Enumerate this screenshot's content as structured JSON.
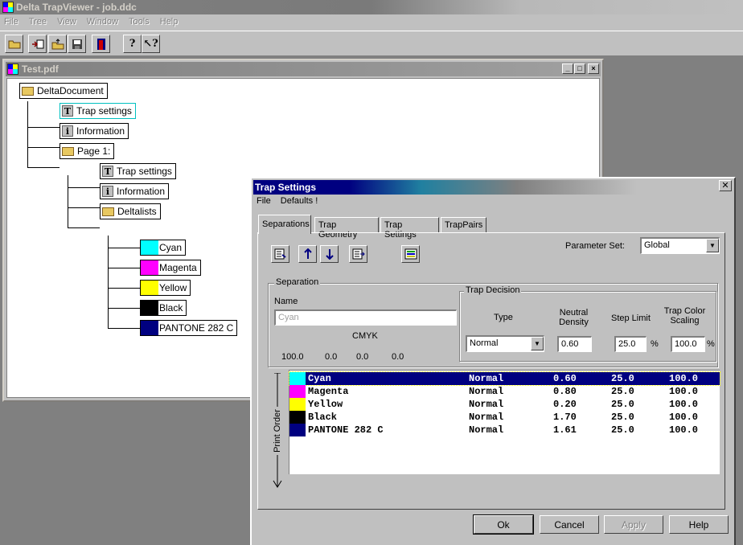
{
  "app": {
    "title": "Delta TrapViewer - job.ddc",
    "menu": [
      "File",
      "Tree",
      "View",
      "Window",
      "Tools",
      "Help"
    ]
  },
  "document": {
    "title": "Test.pdf",
    "tree": {
      "root": "DeltaDocument",
      "root_children": [
        "Trap settings",
        "Information",
        "Page 1:"
      ],
      "page_children": [
        "Trap settings",
        "Information",
        "Deltalists"
      ],
      "deltalists": [
        {
          "name": "Cyan",
          "color": "#00ffff"
        },
        {
          "name": "Magenta",
          "color": "#ff00ff"
        },
        {
          "name": "Yellow",
          "color": "#ffff00"
        },
        {
          "name": "Black",
          "color": "#000000"
        },
        {
          "name": "PANTONE 282 C",
          "color": "#000080"
        }
      ]
    }
  },
  "dialog": {
    "title": "Trap Settings",
    "menu": [
      "File",
      "Defaults !"
    ],
    "tabs": [
      "Separations",
      "Trap Geometry",
      "Trap Settings",
      "TrapPairs"
    ],
    "parameter_set_label": "Parameter Set:",
    "parameter_set_value": "Global",
    "separation_group": "Separation",
    "name_label": "Name",
    "name_placeholder": "Cyan",
    "cmyk_label": "CMYK",
    "cmyk_values": [
      "100.0",
      "0.0",
      "0.0",
      "0.0"
    ],
    "trap_decision_group": "Trap Decision",
    "col_type": "Type",
    "col_neutral_density": "Neutral Density",
    "col_step_limit": "Step Limit",
    "col_trap_color_scaling": "Trap Color Scaling",
    "type_value": "Normal",
    "neutral_density_value": "0.60",
    "step_limit_value": "25.0",
    "trap_color_scaling_value": "100.0",
    "percent": "%",
    "print_order_label": "Print Order",
    "separations": [
      {
        "name": "Cyan",
        "color": "#00ffff",
        "type": "Normal",
        "nd": "0.60",
        "sl": "25.0",
        "tc": "100.0"
      },
      {
        "name": "Magenta",
        "color": "#ff00ff",
        "type": "Normal",
        "nd": "0.80",
        "sl": "25.0",
        "tc": "100.0"
      },
      {
        "name": "Yellow",
        "color": "#ffff00",
        "type": "Normal",
        "nd": "0.20",
        "sl": "25.0",
        "tc": "100.0"
      },
      {
        "name": "Black",
        "color": "#000000",
        "type": "Normal",
        "nd": "1.70",
        "sl": "25.0",
        "tc": "100.0"
      },
      {
        "name": "PANTONE 282 C",
        "color": "#000080",
        "type": "Normal",
        "nd": "1.61",
        "sl": "25.0",
        "tc": "100.0"
      }
    ],
    "buttons": {
      "ok": "Ok",
      "cancel": "Cancel",
      "apply": "Apply",
      "help": "Help"
    }
  }
}
